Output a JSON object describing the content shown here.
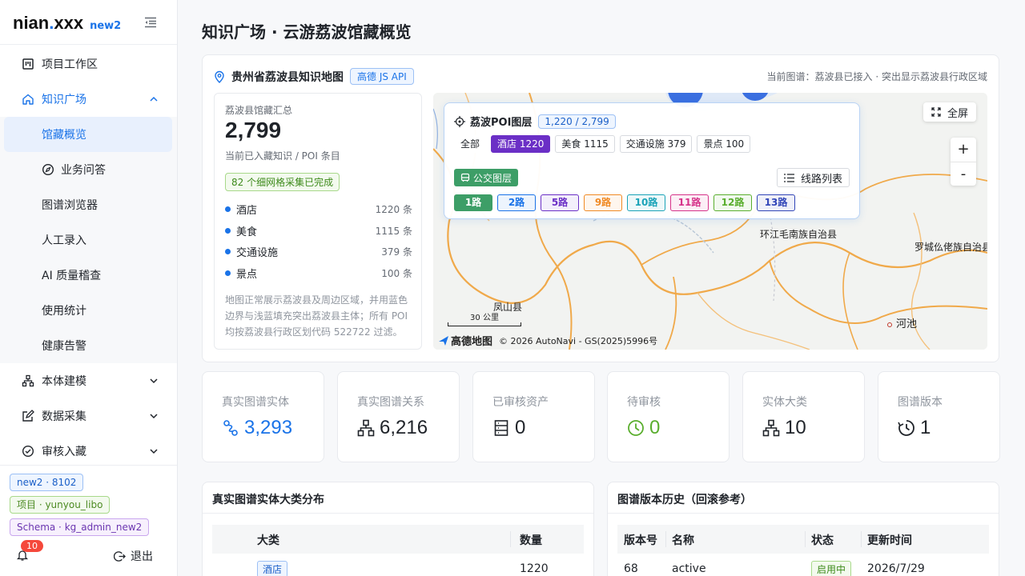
{
  "sidebar": {
    "logo": {
      "main": "nian",
      "dot": ".",
      "tail": "xxx",
      "sub": "new2"
    },
    "nav": {
      "workspace": "项目工作区",
      "knowledge": "知识广场",
      "overview": "馆藏概览",
      "qa": "业务问答",
      "graph_browser": "图谱浏览器",
      "manual_entry": "人工录入",
      "ai_qc": "AI 质量稽查",
      "usage": "使用统计",
      "health": "健康告警",
      "ontology": "本体建模",
      "collect": "数据采集",
      "review": "审核入藏"
    },
    "tags": {
      "env": "new2 · 8102",
      "project": "项目 · yunyou_libo",
      "schema": "Schema · kg_admin_new2"
    },
    "notify_count": "10",
    "logout": "退出"
  },
  "page": {
    "title": "知识广场 · 云游荔波馆藏概览"
  },
  "map_card": {
    "title": "贵州省荔波县知识地图",
    "api_tag": "高德 JS API",
    "status": "当前图谱：荔波县已接入 · 突出显示荔波县行政区域",
    "summary": {
      "label": "荔波县馆藏汇总",
      "total": "2,799",
      "subtitle": "当前已入藏知识 / POI 条目",
      "grid_note": "82 个细网格采集已完成",
      "categories": [
        {
          "name": "酒店",
          "count": "1220 条"
        },
        {
          "name": "美食",
          "count": "1115 条"
        },
        {
          "name": "交通设施",
          "count": "379 条"
        },
        {
          "name": "景点",
          "count": "100 条"
        }
      ],
      "desc": "地图正常展示荔波县及周边区域，并用蓝色边界与浅蓝填充突出荔波县主体；所有 POI 均按荔波县行政区划代码 522722 过滤。"
    },
    "map": {
      "fullscreen": "全屏",
      "zoom_in": "+",
      "zoom_out": "-",
      "places": {
        "huanjiang": "环江毛南族自治县",
        "luocheng": "罗城仫佬族自治县",
        "fengshan": "凤山县",
        "hechi": "河池"
      },
      "scale": "30 公里",
      "brand": "高德地图",
      "copyright": "© 2026 AutoNavi - GS(2025)5996号"
    },
    "poi_layer": {
      "title": "荔波POI图层",
      "count": "1,220 / 2,799",
      "filters": [
        "全部",
        "酒店 1220",
        "美食 1115",
        "交通设施 379",
        "景点 100"
      ],
      "selected_filter": "酒店 1220",
      "bus_layer": "公交图层",
      "route_list": "线路列表",
      "routes": [
        {
          "label": "1路",
          "color": "#3d9e67"
        },
        {
          "label": "2路",
          "color": "#1a73e8"
        },
        {
          "label": "5路",
          "color": "#6b2fc6"
        },
        {
          "label": "9路",
          "color": "#f08a24"
        },
        {
          "label": "10路",
          "color": "#1aa3b8"
        },
        {
          "label": "11路",
          "color": "#d6338a"
        },
        {
          "label": "12路",
          "color": "#5aae2e"
        },
        {
          "label": "13路",
          "color": "#3246b8"
        }
      ]
    }
  },
  "stats": [
    {
      "label": "真实图谱实体",
      "value": "3,293",
      "icon": "entity-icon",
      "color": "#1a73e8"
    },
    {
      "label": "真实图谱关系",
      "value": "6,216",
      "icon": "relation-icon",
      "color": "#1f2329"
    },
    {
      "label": "已审核资产",
      "value": "0",
      "icon": "asset-icon",
      "color": "#1f2329"
    },
    {
      "label": "待审核",
      "value": "0",
      "icon": "clock-icon",
      "color": "#5aae2e"
    },
    {
      "label": "实体大类",
      "value": "10",
      "icon": "category-icon",
      "color": "#1f2329"
    },
    {
      "label": "图谱版本",
      "value": "1",
      "icon": "history-icon",
      "color": "#1f2329"
    }
  ],
  "entity_panel": {
    "title": "真实图谱实体大类分布",
    "headers": [
      "大类",
      "数量"
    ],
    "rows": [
      {
        "type": "酒店",
        "count": "1220"
      }
    ]
  },
  "version_panel": {
    "title": "图谱版本历史（回滚参考）",
    "headers": [
      "版本号",
      "名称",
      "状态",
      "更新时间"
    ],
    "rows": [
      {
        "version": "68",
        "name": "active",
        "status": "启用中",
        "updated": "2026/7/29"
      }
    ]
  }
}
